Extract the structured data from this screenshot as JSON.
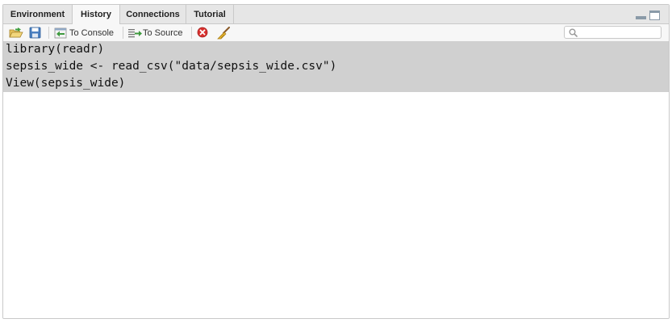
{
  "tabs": {
    "environment": "Environment",
    "history": "History",
    "connections": "Connections",
    "tutorial": "Tutorial"
  },
  "toolbar": {
    "to_console": "To Console",
    "to_source": "To Source",
    "search_placeholder": ""
  },
  "history": {
    "lines": [
      "library(readr)",
      "sepsis_wide <- read_csv(\"data/sepsis_wide.csv\")",
      "View(sepsis_wide)"
    ]
  },
  "colors": {
    "tab_bar": "#e6e6e6",
    "selected_row": "#d0d0d0",
    "delete_red": "#d9312f"
  }
}
